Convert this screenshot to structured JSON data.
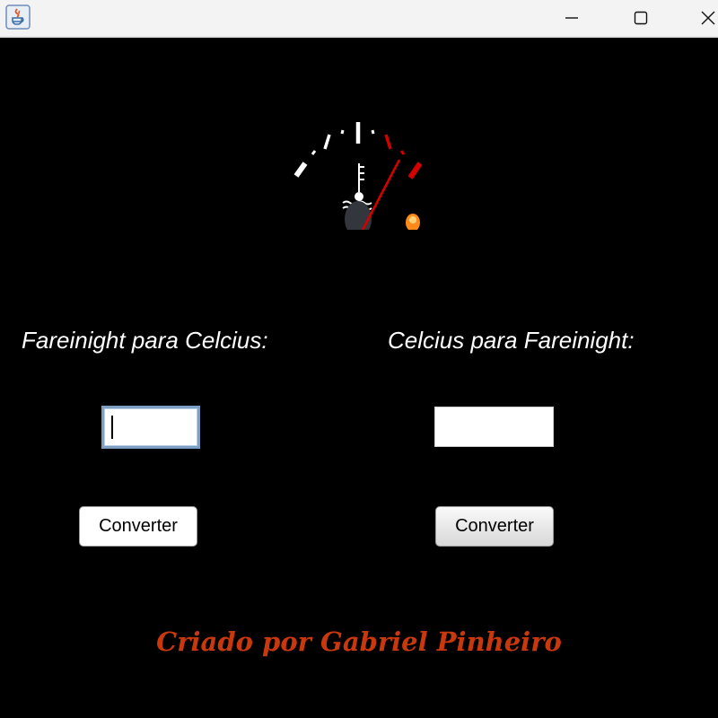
{
  "titlebar": {
    "app_icon": "java-app-icon",
    "controls": {
      "minimize_icon": "minimize-icon",
      "maximize_icon": "maximize-icon",
      "close_icon": "close-icon"
    }
  },
  "gauge": {
    "icon": "temperature-gauge-icon",
    "symbol": "coolant-temperature-icon",
    "needle_color": "#d40000",
    "warning_light_color": "#ff8a1a"
  },
  "converter_f_to_c": {
    "label": "Fareinight para Celcius:",
    "input_value": "",
    "button_label": "Converter"
  },
  "converter_c_to_f": {
    "label": "Celcius para Fareinight:",
    "input_value": "",
    "button_label": "Converter"
  },
  "footer": {
    "credit": "Criado por Gabriel Pinheiro",
    "credit_color": "#c9380c"
  }
}
